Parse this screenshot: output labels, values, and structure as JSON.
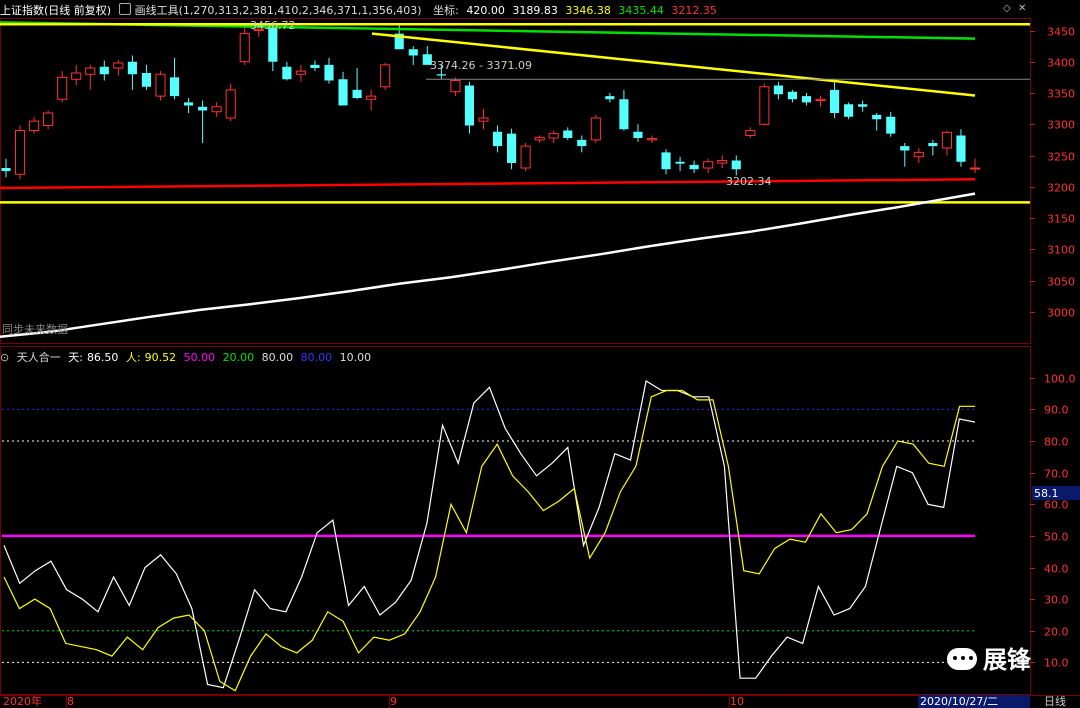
{
  "header": {
    "title": "上证指数(日线 前复权)",
    "tool": "画线工具(1,270,313,2,381,410,2,346,371,1,356,403)",
    "coord_label": "坐标:",
    "coord_value": "420.00",
    "price_value": "3189.83",
    "v1": "3346.38",
    "v2": "3435.44",
    "v3": "3212.35"
  },
  "indicator_header": {
    "name": "天人合一",
    "tian_label": "天:",
    "tian_value": "86.50",
    "ren_label": "人:",
    "ren_value": "90.52",
    "l50": "50.00",
    "l20": "20.00",
    "l80": "80.00",
    "l90": "80.00",
    "l10": "10.00"
  },
  "annotations": {
    "high_label": "3456.72",
    "mid_label": "3374.26 - 3371.09",
    "low_label": "3202.34",
    "bottom_note": "同步未来数据",
    "indicator_marker": "58.1"
  },
  "footer": {
    "year": "2020年",
    "m8": "8",
    "m9": "9",
    "m10": "10",
    "date": "2020/10/27/二",
    "period": "日线"
  },
  "watermark": "展锋",
  "colors": {
    "up": "#ff3232",
    "down": "#54ffff",
    "red_line": "#ff0000",
    "yellow": "#ffff00",
    "green": "#00e000",
    "magenta": "#ff00ff",
    "white_line": "#ffffff",
    "grid_red": "#7a0000"
  },
  "chart_data": [
    {
      "type": "candlestick",
      "title": "上证指数(日线 前复权)",
      "ylim": [
        2950,
        3470
      ],
      "yticks": [
        3000,
        3050,
        3100,
        3150,
        3200,
        3250,
        3300,
        3350,
        3400,
        3450
      ],
      "ohlc": [
        [
          3230,
          3245,
          3215,
          3225
        ],
        [
          3220,
          3298,
          3212,
          3290
        ],
        [
          3290,
          3312,
          3285,
          3305
        ],
        [
          3298,
          3322,
          3292,
          3318
        ],
        [
          3340,
          3385,
          3335,
          3375
        ],
        [
          3372,
          3395,
          3362,
          3382
        ],
        [
          3380,
          3395,
          3355,
          3390
        ],
        [
          3392,
          3402,
          3370,
          3380
        ],
        [
          3390,
          3403,
          3378,
          3398
        ],
        [
          3400,
          3410,
          3355,
          3380
        ],
        [
          3382,
          3395,
          3355,
          3360
        ],
        [
          3345,
          3385,
          3338,
          3380
        ],
        [
          3375,
          3406,
          3340,
          3345
        ],
        [
          3335,
          3342,
          3318,
          3330
        ],
        [
          3328,
          3338,
          3270,
          3322
        ],
        [
          3320,
          3335,
          3312,
          3328
        ],
        [
          3310,
          3365,
          3305,
          3355
        ],
        [
          3400,
          3458,
          3395,
          3445
        ],
        [
          3450,
          3462,
          3440,
          3452
        ],
        [
          3455,
          3462,
          3385,
          3400
        ],
        [
          3392,
          3400,
          3370,
          3372
        ],
        [
          3380,
          3395,
          3368,
          3385
        ],
        [
          3395,
          3402,
          3385,
          3390
        ],
        [
          3395,
          3406,
          3365,
          3370
        ],
        [
          3372,
          3384,
          3330,
          3330
        ],
        [
          3355,
          3390,
          3340,
          3342
        ],
        [
          3340,
          3355,
          3322,
          3345
        ],
        [
          3360,
          3398,
          3355,
          3395
        ],
        [
          3445,
          3458,
          3420,
          3420
        ],
        [
          3420,
          3425,
          3395,
          3410
        ],
        [
          3412,
          3425,
          3400,
          3395
        ],
        [
          3380,
          3395,
          3372,
          3378
        ],
        [
          3352,
          3375,
          3345,
          3370
        ],
        [
          3362,
          3368,
          3285,
          3298
        ],
        [
          3305,
          3325,
          3292,
          3310
        ],
        [
          3288,
          3298,
          3255,
          3265
        ],
        [
          3285,
          3293,
          3228,
          3238
        ],
        [
          3230,
          3270,
          3225,
          3265
        ],
        [
          3275,
          3282,
          3270,
          3279
        ],
        [
          3278,
          3290,
          3270,
          3285
        ],
        [
          3290,
          3295,
          3275,
          3278
        ],
        [
          3275,
          3282,
          3255,
          3265
        ],
        [
          3275,
          3315,
          3270,
          3310
        ],
        [
          3345,
          3350,
          3335,
          3340
        ],
        [
          3340,
          3355,
          3290,
          3292
        ],
        [
          3288,
          3300,
          3272,
          3278
        ],
        [
          3275,
          3282,
          3270,
          3277
        ],
        [
          3255,
          3260,
          3220,
          3228
        ],
        [
          3240,
          3248,
          3225,
          3237
        ],
        [
          3235,
          3242,
          3222,
          3228
        ],
        [
          3230,
          3245,
          3222,
          3240
        ],
        [
          3238,
          3250,
          3230,
          3242
        ],
        [
          3242,
          3250,
          3218,
          3228
        ],
        [
          3282,
          3295,
          3278,
          3290
        ],
        [
          3300,
          3365,
          3298,
          3360
        ],
        [
          3362,
          3368,
          3340,
          3348
        ],
        [
          3352,
          3355,
          3335,
          3340
        ],
        [
          3345,
          3350,
          3330,
          3335
        ],
        [
          3338,
          3345,
          3328,
          3340
        ],
        [
          3355,
          3372,
          3310,
          3318
        ],
        [
          3332,
          3335,
          3308,
          3312
        ],
        [
          3332,
          3338,
          3320,
          3328
        ],
        [
          3315,
          3318,
          3290,
          3308
        ],
        [
          3312,
          3320,
          3280,
          3285
        ],
        [
          3265,
          3270,
          3232,
          3258
        ],
        [
          3248,
          3262,
          3238,
          3255
        ],
        [
          3270,
          3275,
          3250,
          3265
        ],
        [
          3262,
          3290,
          3250,
          3287
        ],
        [
          3282,
          3292,
          3232,
          3240
        ],
        [
          3230,
          3245,
          3222,
          3230
        ]
      ],
      "lines": [
        {
          "color": "green",
          "x": [
            0,
            975
          ],
          "y": [
            3463,
            3437
          ]
        },
        {
          "color": "yellow",
          "x": [
            372,
            975
          ],
          "y": [
            3445,
            3346
          ]
        },
        {
          "color": "red",
          "x": [
            0,
            975
          ],
          "y": [
            3198,
            3212
          ]
        },
        {
          "color": "yellow",
          "x": [
            0,
            1030
          ],
          "y": [
            3460,
            3460
          ]
        },
        {
          "color": "yellow",
          "x": [
            0,
            1030
          ],
          "y": [
            3175,
            3175
          ]
        },
        {
          "color": "white",
          "x": [
            0,
            50,
            100,
            150,
            200,
            250,
            300,
            350,
            400,
            450,
            500,
            550,
            600,
            650,
            700,
            750,
            800,
            850,
            900,
            975
          ],
          "y": [
            2960,
            2968,
            2980,
            2992,
            3003,
            3012,
            3022,
            3033,
            3045,
            3055,
            3067,
            3080,
            3092,
            3105,
            3117,
            3128,
            3141,
            3155,
            3168,
            3189
          ]
        }
      ]
    },
    {
      "type": "line",
      "title": "天人合一",
      "ylim": [
        0,
        105
      ],
      "yticks": [
        10,
        20,
        30,
        40,
        50,
        60,
        70,
        80,
        90,
        100
      ],
      "hlines": [
        {
          "y": 90,
          "color": "blue"
        },
        {
          "y": 80,
          "color": "white"
        },
        {
          "y": 50,
          "color": "magenta"
        },
        {
          "y": 20,
          "color": "green"
        },
        {
          "y": 10,
          "color": "white"
        }
      ],
      "series": [
        {
          "name": "天",
          "color": "white",
          "values": [
            47,
            35,
            39,
            42,
            33,
            30,
            26,
            37,
            28,
            40,
            44,
            38,
            27,
            3,
            2,
            17,
            33,
            27,
            26,
            37,
            51,
            55,
            28,
            34,
            25,
            29,
            36,
            54,
            85,
            73,
            92,
            97,
            84,
            76,
            69,
            73,
            78,
            47,
            59,
            76,
            74,
            99,
            96,
            96,
            94,
            94,
            72,
            5,
            5,
            12,
            18,
            16,
            34,
            25,
            27,
            34,
            53,
            72,
            70,
            60,
            59,
            87,
            86
          ]
        },
        {
          "name": "人",
          "color": "yellow",
          "values": [
            37,
            27,
            30,
            27,
            16,
            15,
            14,
            12,
            18,
            14,
            21,
            24,
            25,
            20,
            4,
            1,
            12,
            19,
            15,
            13,
            17,
            26,
            23,
            13,
            18,
            17,
            19,
            26,
            37,
            60,
            51,
            72,
            79,
            69,
            64,
            58,
            61,
            65,
            43,
            51,
            64,
            72,
            94,
            96,
            96,
            93,
            93,
            72,
            39,
            38,
            46,
            49,
            48,
            57,
            51,
            52,
            57,
            72,
            80,
            79,
            73,
            72,
            91,
            91
          ]
        }
      ]
    }
  ]
}
